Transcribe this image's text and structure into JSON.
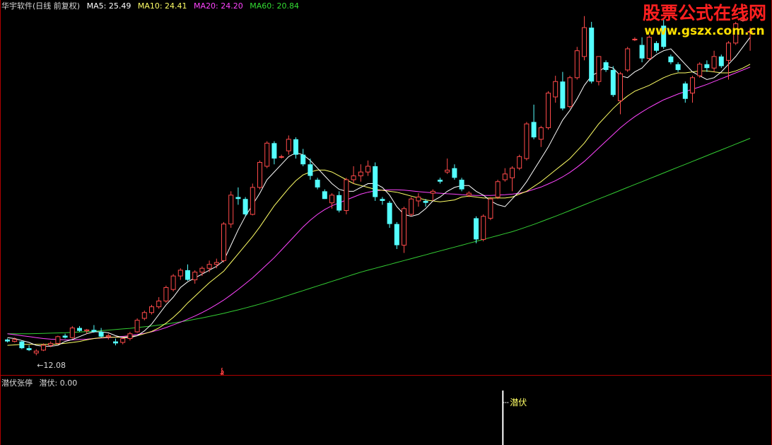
{
  "header": {
    "title": "华宇软件(日线 前复权)",
    "ma5_label": "MA5:",
    "ma5_value": "25.49",
    "ma10_label": "MA10:",
    "ma10_value": "24.41",
    "ma20_label": "MA20:",
    "ma20_value": "24.20",
    "ma60_label": "MA60:",
    "ma60_value": "20.84"
  },
  "colors": {
    "up": "#ff4a4a",
    "down": "#54ffff",
    "ma5": "#ffffff",
    "ma10": "#ffff66",
    "ma20": "#ff44ff",
    "ma60": "#33cc33",
    "border": "#b00000"
  },
  "watermark": {
    "cn": "股票公式在线网",
    "url": "www.gszx.com.cn"
  },
  "low_marker": "←12.08",
  "signal_icon": "s-arrow-icon",
  "indicator": {
    "name": "潜伏张停",
    "series_label": "潜伏:",
    "value": "0.00",
    "signal_label": "潜伏",
    "signal_strength": 1
  },
  "chart_data": {
    "type": "candlestick",
    "ylim": [
      11.5,
      29.8
    ],
    "candles": [
      [
        12.9,
        12.95,
        12.75,
        12.8
      ],
      [
        12.8,
        13.0,
        12.75,
        12.9
      ],
      [
        12.8,
        12.85,
        12.4,
        12.45
      ],
      [
        12.45,
        12.6,
        12.3,
        12.35
      ],
      [
        12.2,
        12.4,
        12.08,
        12.3
      ],
      [
        12.35,
        12.7,
        12.3,
        12.6
      ],
      [
        12.6,
        12.8,
        12.5,
        12.7
      ],
      [
        12.7,
        13.1,
        12.65,
        13.05
      ],
      [
        13.1,
        13.2,
        12.95,
        13.0
      ],
      [
        13.0,
        13.6,
        12.95,
        13.5
      ],
      [
        13.5,
        13.6,
        13.3,
        13.35
      ],
      [
        13.35,
        13.45,
        13.2,
        13.4
      ],
      [
        13.4,
        13.65,
        13.25,
        13.3
      ],
      [
        13.3,
        13.5,
        13.0,
        13.05
      ],
      [
        13.05,
        13.2,
        12.9,
        13.1
      ],
      [
        12.8,
        12.95,
        12.6,
        12.7
      ],
      [
        12.75,
        13.0,
        12.65,
        12.95
      ],
      [
        12.95,
        13.3,
        12.85,
        13.2
      ],
      [
        13.3,
        14.0,
        13.25,
        13.9
      ],
      [
        14.0,
        14.4,
        13.9,
        14.3
      ],
      [
        14.3,
        14.7,
        14.2,
        14.6
      ],
      [
        14.6,
        15.1,
        14.5,
        14.9
      ],
      [
        14.9,
        15.7,
        14.8,
        15.6
      ],
      [
        15.5,
        16.3,
        15.4,
        16.2
      ],
      [
        16.2,
        16.6,
        16.0,
        16.5
      ],
      [
        16.5,
        16.8,
        15.95,
        16.0
      ],
      [
        16.0,
        16.5,
        15.8,
        16.4
      ],
      [
        16.4,
        16.7,
        16.2,
        16.6
      ],
      [
        16.6,
        17.0,
        16.4,
        16.8
      ],
      [
        16.8,
        17.1,
        16.6,
        16.9
      ],
      [
        17.0,
        19.0,
        16.9,
        18.9
      ],
      [
        18.9,
        20.6,
        18.7,
        20.4
      ],
      [
        20.3,
        20.8,
        19.9,
        20.2
      ],
      [
        20.2,
        20.3,
        19.3,
        19.4
      ],
      [
        19.4,
        21.0,
        19.35,
        20.8
      ],
      [
        20.8,
        22.2,
        20.7,
        22.1
      ],
      [
        21.9,
        23.2,
        21.8,
        23.1
      ],
      [
        23.1,
        23.2,
        22.0,
        22.3
      ],
      [
        22.4,
        22.5,
        22.3,
        22.4
      ],
      [
        22.7,
        23.5,
        22.5,
        23.3
      ],
      [
        23.3,
        23.4,
        22.3,
        22.5
      ],
      [
        22.5,
        22.8,
        21.9,
        22.0
      ],
      [
        22.0,
        22.3,
        21.2,
        21.4
      ],
      [
        21.2,
        21.3,
        20.7,
        20.8
      ],
      [
        20.6,
        20.7,
        20.2,
        20.2
      ],
      [
        20.0,
        20.5,
        19.7,
        20.4
      ],
      [
        20.4,
        20.6,
        19.5,
        19.6
      ],
      [
        19.6,
        21.3,
        19.4,
        21.2
      ],
      [
        21.2,
        21.9,
        21.0,
        21.4
      ],
      [
        21.4,
        22.0,
        21.1,
        21.6
      ],
      [
        21.6,
        22.2,
        21.4,
        21.9
      ],
      [
        21.9,
        22.1,
        20.1,
        20.3
      ],
      [
        20.2,
        20.3,
        19.9,
        20.1
      ],
      [
        20.0,
        20.1,
        18.7,
        18.9
      ],
      [
        18.9,
        19.0,
        17.6,
        17.8
      ],
      [
        17.8,
        19.8,
        17.4,
        19.7
      ],
      [
        19.4,
        20.3,
        19.3,
        20.2
      ],
      [
        20.1,
        20.5,
        19.8,
        20.3
      ],
      [
        20.1,
        20.2,
        19.8,
        20.0
      ],
      [
        20.5,
        20.7,
        20.1,
        20.6
      ],
      [
        21.2,
        21.3,
        21.0,
        21.1
      ],
      [
        21.6,
        22.3,
        21.5,
        21.7
      ],
      [
        21.8,
        22.0,
        21.2,
        21.3
      ],
      [
        21.2,
        21.3,
        20.6,
        20.7
      ],
      [
        20.4,
        20.6,
        20.3,
        20.5
      ],
      [
        19.2,
        19.3,
        17.9,
        18.1
      ],
      [
        18.1,
        19.4,
        18.0,
        19.3
      ],
      [
        19.2,
        20.3,
        19.1,
        20.2
      ],
      [
        20.3,
        21.2,
        20.2,
        21.1
      ],
      [
        21.2,
        21.8,
        21.1,
        21.5
      ],
      [
        21.3,
        21.9,
        20.6,
        21.8
      ],
      [
        21.8,
        22.5,
        21.7,
        22.4
      ],
      [
        22.3,
        24.2,
        22.2,
        24.1
      ],
      [
        24.2,
        25.1,
        23.3,
        23.4
      ],
      [
        23.3,
        24.0,
        22.9,
        23.9
      ],
      [
        23.9,
        25.8,
        23.8,
        25.7
      ],
      [
        25.5,
        26.6,
        25.2,
        26.3
      ],
      [
        26.3,
        26.8,
        24.8,
        24.9
      ],
      [
        25.0,
        26.6,
        24.9,
        26.5
      ],
      [
        26.5,
        28.1,
        26.4,
        27.9
      ],
      [
        27.6,
        29.7,
        27.4,
        29.1
      ],
      [
        29.1,
        29.4,
        26.2,
        26.3
      ],
      [
        26.3,
        27.6,
        26.1,
        27.6
      ],
      [
        27.3,
        27.4,
        26.8,
        26.9
      ],
      [
        26.9,
        27.1,
        25.5,
        25.6
      ],
      [
        25.3,
        26.8,
        24.6,
        26.7
      ],
      [
        26.9,
        28.1,
        26.8,
        28.0
      ],
      [
        28.5,
        28.6,
        28.4,
        28.5
      ],
      [
        28.2,
        28.6,
        27.3,
        27.5
      ],
      [
        27.5,
        28.7,
        27.4,
        28.6
      ],
      [
        28.3,
        28.4,
        27.8,
        27.9
      ],
      [
        29.2,
        29.6,
        28.0,
        28.1
      ],
      [
        27.6,
        27.7,
        27.2,
        27.3
      ],
      [
        27.2,
        27.3,
        26.8,
        26.9
      ],
      [
        26.2,
        26.3,
        25.2,
        25.4
      ],
      [
        25.7,
        26.6,
        25.2,
        26.5
      ],
      [
        26.6,
        27.3,
        26.5,
        27.2
      ],
      [
        27.2,
        27.4,
        26.8,
        27.0
      ],
      [
        27.0,
        27.9,
        26.8,
        27.6
      ],
      [
        27.6,
        27.7,
        27.0,
        27.1
      ],
      [
        27.4,
        28.4,
        26.4,
        28.3
      ],
      [
        28.3,
        29.4,
        28.2,
        29.3
      ],
      [
        29.5,
        29.6,
        29.4,
        29.5
      ],
      [
        28.9,
        29.1,
        27.9,
        28.9
      ]
    ],
    "ma5": [
      13.0,
      12.95,
      12.85,
      12.75,
      12.6,
      12.55,
      12.55,
      12.6,
      12.8,
      12.9,
      13.05,
      13.2,
      13.3,
      13.3,
      13.25,
      13.1,
      13.0,
      13.0,
      13.1,
      13.35,
      13.7,
      14.2,
      14.7,
      15.1,
      15.6,
      15.9,
      16.1,
      16.3,
      16.5,
      16.7,
      17.0,
      17.8,
      18.6,
      19.3,
      19.9,
      20.5,
      21.2,
      21.6,
      22.0,
      22.4,
      22.6,
      22.5,
      22.2,
      21.8,
      21.4,
      21.0,
      20.7,
      20.6,
      20.6,
      20.8,
      21.0,
      21.0,
      20.8,
      20.4,
      19.8,
      19.4,
      19.3,
      19.4,
      19.7,
      20.1,
      20.3,
      20.6,
      20.8,
      20.9,
      20.9,
      20.6,
      20.4,
      20.1,
      19.9,
      19.8,
      20.2,
      20.6,
      21.1,
      21.7,
      22.3,
      22.9,
      23.6,
      24.3,
      24.8,
      25.4,
      26.1,
      26.6,
      26.8,
      27.1,
      27.0,
      26.6,
      26.5,
      26.8,
      27.0,
      27.4,
      27.7,
      27.9,
      28.0,
      27.6,
      27.2,
      26.8,
      26.6,
      26.4,
      26.5,
      26.8,
      27.2,
      27.6,
      28.1,
      28.6
    ],
    "ma10": [
      12.6,
      12.62,
      12.65,
      12.65,
      12.65,
      12.65,
      12.65,
      12.66,
      12.7,
      12.75,
      12.8,
      12.88,
      12.95,
      13.0,
      13.02,
      13.02,
      13.02,
      13.05,
      13.1,
      13.2,
      13.32,
      13.5,
      13.75,
      14.05,
      14.4,
      14.8,
      15.15,
      15.5,
      15.85,
      16.15,
      16.45,
      16.9,
      17.35,
      17.8,
      18.25,
      18.75,
      19.3,
      19.85,
      20.3,
      20.75,
      21.15,
      21.45,
      21.6,
      21.7,
      21.7,
      21.6,
      21.4,
      21.2,
      21.0,
      20.9,
      20.8,
      20.7,
      20.65,
      20.6,
      20.55,
      20.45,
      20.35,
      20.25,
      20.15,
      20.1,
      20.05,
      20.1,
      20.15,
      20.3,
      20.35,
      20.3,
      20.25,
      20.25,
      20.25,
      20.25,
      20.3,
      20.45,
      20.6,
      20.85,
      21.1,
      21.4,
      21.7,
      22.0,
      22.3,
      22.7,
      23.1,
      23.6,
      24.1,
      24.5,
      24.9,
      25.25,
      25.55,
      25.8,
      25.95,
      26.1,
      26.3,
      26.5,
      26.65,
      26.75,
      26.75,
      26.8,
      26.85,
      26.85,
      26.8,
      26.75,
      26.75,
      26.85,
      27.0,
      27.2
    ],
    "ma20": [
      13.2,
      13.15,
      13.1,
      13.05,
      13.0,
      12.95,
      12.92,
      12.9,
      12.88,
      12.88,
      12.9,
      12.92,
      12.95,
      12.98,
      13.0,
      13.03,
      13.06,
      13.1,
      13.16,
      13.22,
      13.3,
      13.4,
      13.52,
      13.66,
      13.8,
      13.96,
      14.12,
      14.3,
      14.5,
      14.72,
      14.95,
      15.22,
      15.5,
      15.8,
      16.1,
      16.45,
      16.8,
      17.15,
      17.55,
      17.95,
      18.35,
      18.75,
      19.1,
      19.4,
      19.65,
      19.85,
      20.0,
      20.15,
      20.3,
      20.45,
      20.55,
      20.62,
      20.66,
      20.68,
      20.68,
      20.66,
      20.62,
      20.58,
      20.55,
      20.52,
      20.5,
      20.47,
      20.45,
      20.42,
      20.4,
      20.38,
      20.38,
      20.38,
      20.4,
      20.42,
      20.45,
      20.5,
      20.58,
      20.7,
      20.82,
      20.98,
      21.15,
      21.35,
      21.58,
      21.85,
      22.15,
      22.5,
      22.85,
      23.2,
      23.55,
      23.9,
      24.2,
      24.48,
      24.72,
      24.95,
      25.15,
      25.35,
      25.5,
      25.65,
      25.78,
      25.9,
      26.02,
      26.15,
      26.3,
      26.45,
      26.6,
      26.75,
      26.9,
      27.05
    ],
    "ma60": [
      13.2,
      13.2,
      13.2,
      13.2,
      13.21,
      13.22,
      13.23,
      13.24,
      13.25,
      13.27,
      13.29,
      13.31,
      13.33,
      13.36,
      13.39,
      13.42,
      13.45,
      13.48,
      13.52,
      13.56,
      13.6,
      13.65,
      13.7,
      13.76,
      13.82,
      13.88,
      13.95,
      14.02,
      14.1,
      14.18,
      14.26,
      14.35,
      14.44,
      14.54,
      14.64,
      14.74,
      14.85,
      14.96,
      15.08,
      15.2,
      15.32,
      15.44,
      15.56,
      15.68,
      15.8,
      15.92,
      16.04,
      16.16,
      16.28,
      16.4,
      16.5,
      16.6,
      16.7,
      16.8,
      16.9,
      17.0,
      17.1,
      17.2,
      17.3,
      17.4,
      17.5,
      17.6,
      17.7,
      17.8,
      17.9,
      18.0,
      18.1,
      18.2,
      18.3,
      18.4,
      18.5,
      18.62,
      18.75,
      18.88,
      19.02,
      19.16,
      19.3,
      19.45,
      19.6,
      19.75,
      19.9,
      20.05,
      20.2,
      20.35,
      20.5,
      20.65,
      20.8,
      20.95,
      21.1,
      21.25,
      21.4,
      21.55,
      21.7,
      21.85,
      22.0,
      22.15,
      22.3,
      22.45,
      22.6,
      22.75,
      22.9,
      23.05,
      23.2,
      23.35
    ],
    "low_marker_index": 4,
    "low_marker_value": 12.08,
    "signal_index": 30,
    "indicator_signal_index": 69
  }
}
